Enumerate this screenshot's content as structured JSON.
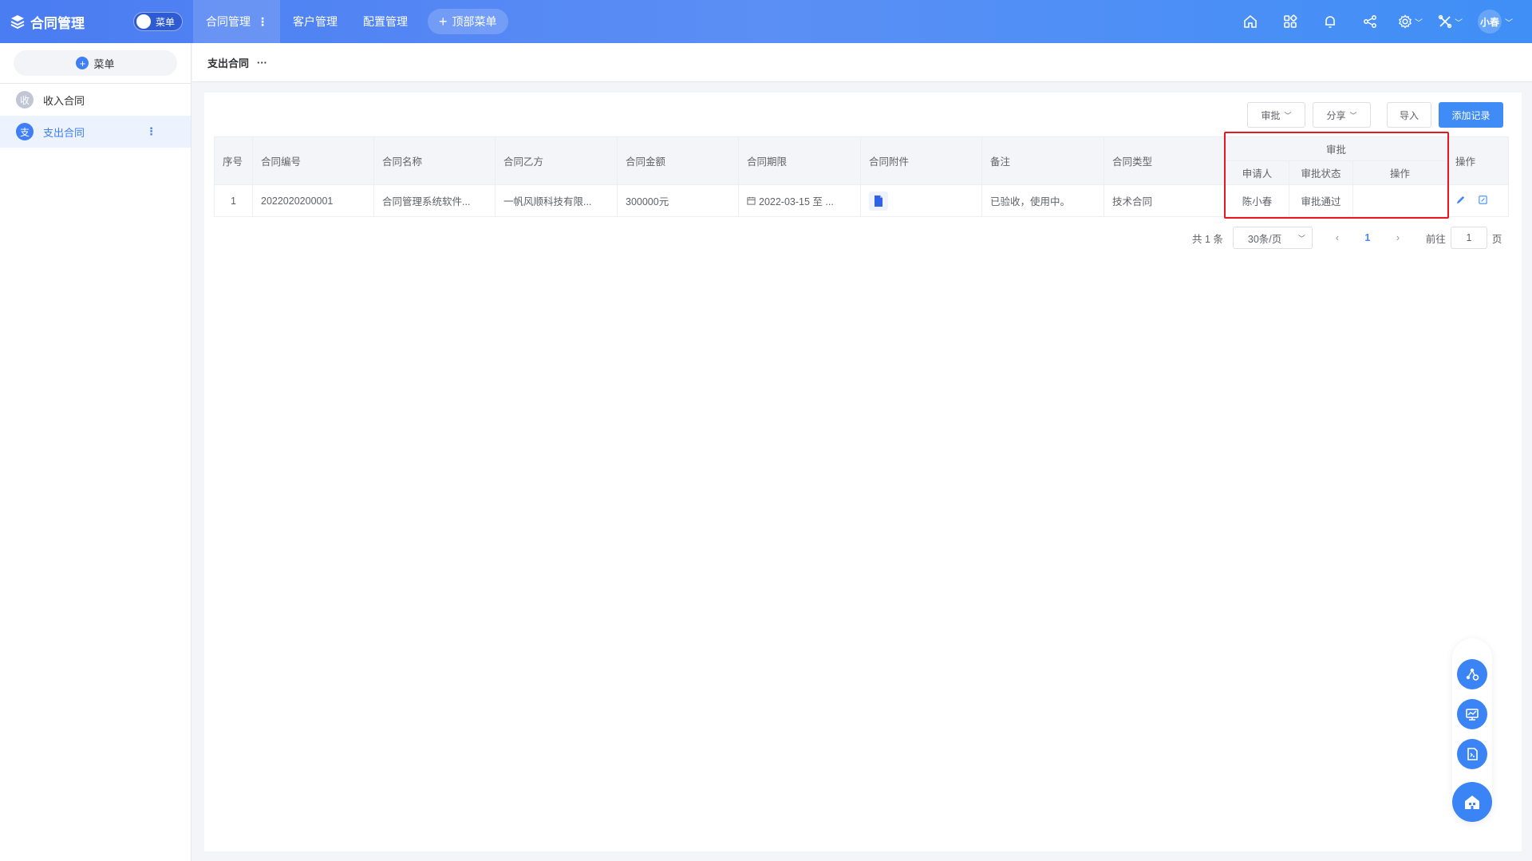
{
  "app": {
    "title": "合同管理",
    "menu_toggle_label": "菜单"
  },
  "top_nav": {
    "items": [
      {
        "label": "合同管理",
        "active": true
      },
      {
        "label": "客户管理"
      },
      {
        "label": "配置管理"
      }
    ],
    "add_label": "顶部菜单"
  },
  "header_icons": [
    "home-icon",
    "apps-grid-icon",
    "bell-icon",
    "share-icon",
    "gear-icon",
    "tools-icon"
  ],
  "user": {
    "name": "小春"
  },
  "sidebar": {
    "add_label": "菜单",
    "items": [
      {
        "badge": "收",
        "label": "收入合同"
      },
      {
        "badge": "支",
        "label": "支出合同",
        "active": true
      }
    ]
  },
  "breadcrumb": {
    "title": "支出合同"
  },
  "toolbar": {
    "approve_label": "审批",
    "share_label": "分享",
    "import_label": "导入",
    "add_record_label": "添加记录"
  },
  "table": {
    "headers": {
      "index": "序号",
      "code": "合同编号",
      "name": "合同名称",
      "party_b": "合同乙方",
      "amount": "合同金额",
      "period": "合同期限",
      "attachment": "合同附件",
      "remark": "备注",
      "type": "合同类型",
      "approval_group": "审批",
      "applicant": "申请人",
      "approval_status": "审批状态",
      "approval_action": "操作",
      "actions": "操作"
    },
    "rows": [
      {
        "index": "1",
        "code": "2022020200001",
        "name": "合同管理系统软件...",
        "party_b": "一帆风顺科技有限...",
        "amount": "300000元",
        "period": "2022-03-15 至 ...",
        "remark": "已验收，使用中。",
        "type": "技术合同",
        "applicant": "陈小春",
        "approval_status": "审批通过",
        "approval_action": ""
      }
    ]
  },
  "pagination": {
    "total": "共 1 条",
    "page_size": "30条/页",
    "current_page": "1",
    "goto_label": "前往",
    "goto_value": "1",
    "page_suffix": "页"
  },
  "colors": {
    "primary": "#3f8cf7",
    "topbar": "#4a7cf2",
    "highlight_box": "#e5191f"
  }
}
